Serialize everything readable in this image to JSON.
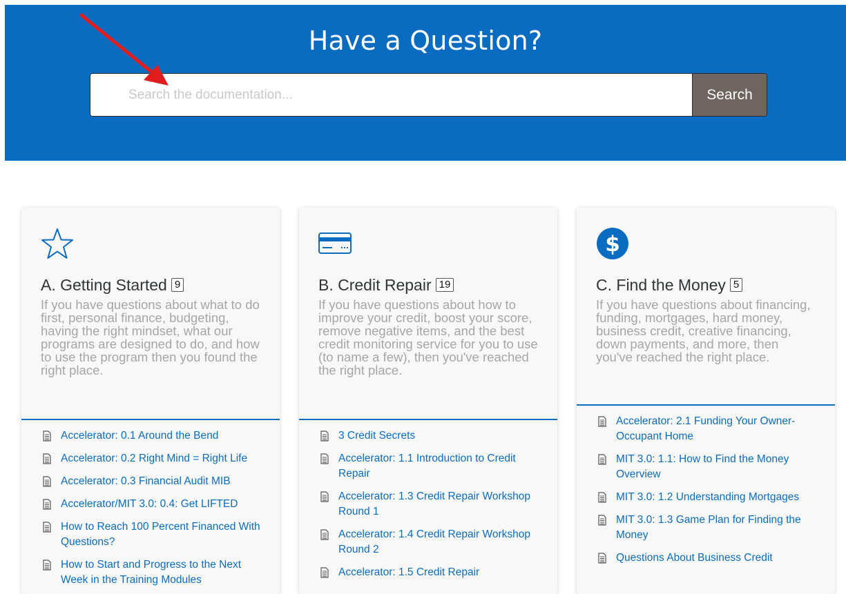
{
  "hero": {
    "title": "Have a Question?",
    "search_placeholder": "Search the documentation...",
    "search_button": "Search"
  },
  "colors": {
    "brand_blue": "#0a6cc1",
    "search_button": "#6e6560",
    "annotation_arrow": "#e11c1c"
  },
  "categories": [
    {
      "icon": "star-icon",
      "title": "A. Getting Started",
      "count": "9",
      "description": "If you have questions about what to do first, personal finance, budgeting, having the right mindset, what our programs are designed to do, and how to use the program then you found the right place.",
      "articles": [
        "Accelerator: 0.1 Around the Bend",
        "Accelerator: 0.2 Right Mind = Right Life",
        "Accelerator: 0.3 Financial Audit MIB",
        "Accelerator/MIT 3.0: 0.4: Get LIFTED",
        "How to Reach 100 Percent Financed With Questions?",
        "How to Start and Progress to the Next Week in the Training Modules"
      ]
    },
    {
      "icon": "credit-card-icon",
      "title": "B. Credit Repair",
      "count": "19",
      "description": "If you have questions about how to improve your credit, boost your score, remove negative items, and the best credit monitoring service for you to use (to name a few), then you've reached the right place.",
      "articles": [
        "3 Credit Secrets",
        "Accelerator: 1.1 Introduction to Credit Repair",
        "Accelerator: 1.3 Credit Repair Workshop Round 1",
        "Accelerator: 1.4 Credit Repair Workshop Round 2",
        "Accelerator: 1.5 Credit Repair"
      ]
    },
    {
      "icon": "dollar-icon",
      "title": "C. Find the Money",
      "count": "5",
      "description": "If you have questions about financing, funding, mortgages, hard money, business credit, creative financing, down payments, and more, then you've reached the right place.",
      "articles": [
        "Accelerator: 2.1 Funding Your Owner-Occupant Home",
        "MIT 3.0: 1.1: How to Find the Money Overview",
        "MIT 3.0: 1.2 Understanding Mortgages",
        "MIT 3.0: 1.3 Game Plan for Finding the Money",
        "Questions About Business Credit"
      ]
    }
  ]
}
